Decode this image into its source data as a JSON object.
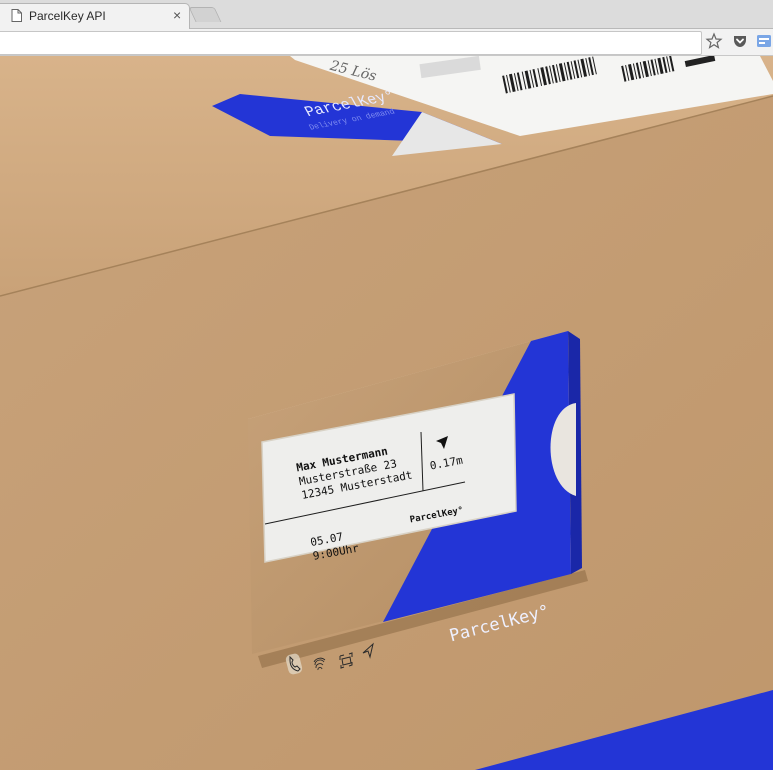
{
  "browser": {
    "tab_title": "ParcelKey API",
    "tab_close_icon": "close-icon",
    "address_value": "",
    "icons": [
      "bookmark-star-icon",
      "pocket-icon",
      "extension-icon"
    ]
  },
  "shipping_label": {
    "logo_text": "ParcelKey°",
    "tagline": "Delivery on demand",
    "handwritten": "25 Lös"
  },
  "device": {
    "recipient_name": "Max Mustermann",
    "street": "Musterstraße 23",
    "city": "12345 Musterstadt",
    "distance": "0.17m",
    "date": "05.07",
    "time": "9:00Uhr",
    "display_brand": "ParcelKey°",
    "body_brand": "ParcelKey°",
    "buttons": [
      "phone-icon",
      "fingerprint-icon",
      "qr-icon",
      "navigation-icon"
    ]
  },
  "colors": {
    "brand_blue": "#2335d6",
    "cardboard": "#c8a27a"
  }
}
